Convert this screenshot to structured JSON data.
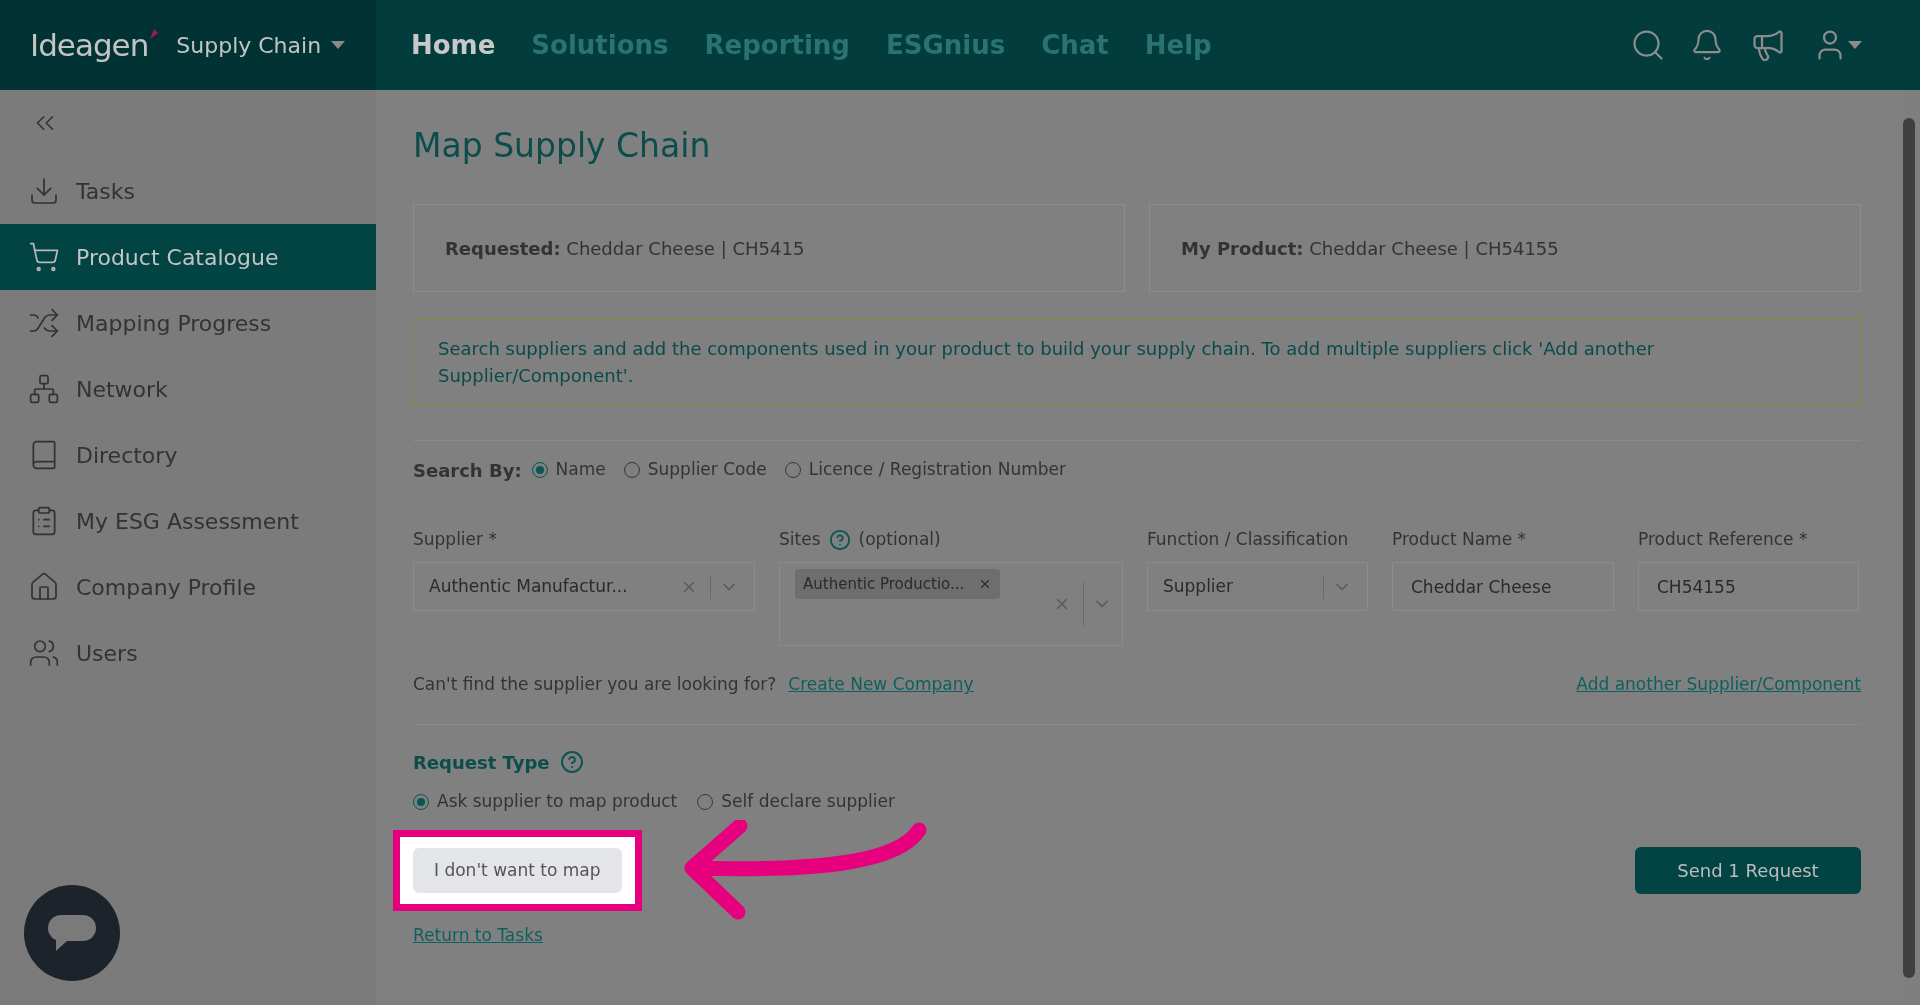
{
  "header": {
    "logo": "Ideagen",
    "product": "Supply Chain",
    "nav": [
      {
        "label": "Home",
        "selected": true
      },
      {
        "label": "Solutions",
        "selected": false
      },
      {
        "label": "Reporting",
        "selected": false
      },
      {
        "label": "ESGnius",
        "selected": false
      },
      {
        "label": "Chat",
        "selected": false
      },
      {
        "label": "Help",
        "selected": false
      }
    ]
  },
  "sidebar": {
    "items": [
      {
        "label": "Tasks",
        "selected": false
      },
      {
        "label": "Product Catalogue",
        "selected": true
      },
      {
        "label": "Mapping Progress",
        "selected": false
      },
      {
        "label": "Network",
        "selected": false
      },
      {
        "label": "Directory",
        "selected": false
      },
      {
        "label": "My ESG Assessment",
        "selected": false
      },
      {
        "label": "Company Profile",
        "selected": false
      },
      {
        "label": "Users",
        "selected": false
      }
    ]
  },
  "page": {
    "title": "Map Supply Chain"
  },
  "summary": [
    "**Requested:** Cheddar Cheese | CH5415",
    "**My Product:** Cheddar Cheese | CH54155"
  ],
  "info": "Search suppliers and add the components used in your product to build your supply chain. To add multiple suppliers click 'Add another Supplier/Component'.",
  "search_by": {
    "label": "Search By:",
    "options": [
      {
        "label": "Name",
        "selected": true
      },
      {
        "label": "Supplier Code",
        "selected": false
      },
      {
        "label": "Licence / Registration Number",
        "selected": false
      }
    ]
  },
  "fields": [
    {
      "kind": "select",
      "label": "Supplier *",
      "value": "Authentic Manufactur...",
      "clearable": true
    },
    {
      "kind": "multi",
      "label": "Sites",
      "hint": "(optional)",
      "tags": [
        "Authentic Productio..."
      ]
    },
    {
      "kind": "select",
      "label": "Function / Classification",
      "value": "Supplier",
      "clearable": false
    },
    {
      "kind": "text",
      "label": "Product Name *",
      "value": "Cheddar Cheese"
    },
    {
      "kind": "text",
      "label": "Product Reference *",
      "value": "CH54155"
    }
  ],
  "missing": {
    "text": "Can't find the supplier you are looking for?",
    "link": "Create New Company"
  },
  "add_link": "Add another Supplier/Component",
  "request_type": {
    "label": "Request Type",
    "options": [
      {
        "label": "Ask supplier to map product",
        "selected": true
      },
      {
        "label": "Self declare supplier",
        "selected": false
      }
    ]
  },
  "buttons": {
    "skip": "I don't want to map",
    "send": "Send 1 Request"
  },
  "return_link": "Return to Tasks"
}
